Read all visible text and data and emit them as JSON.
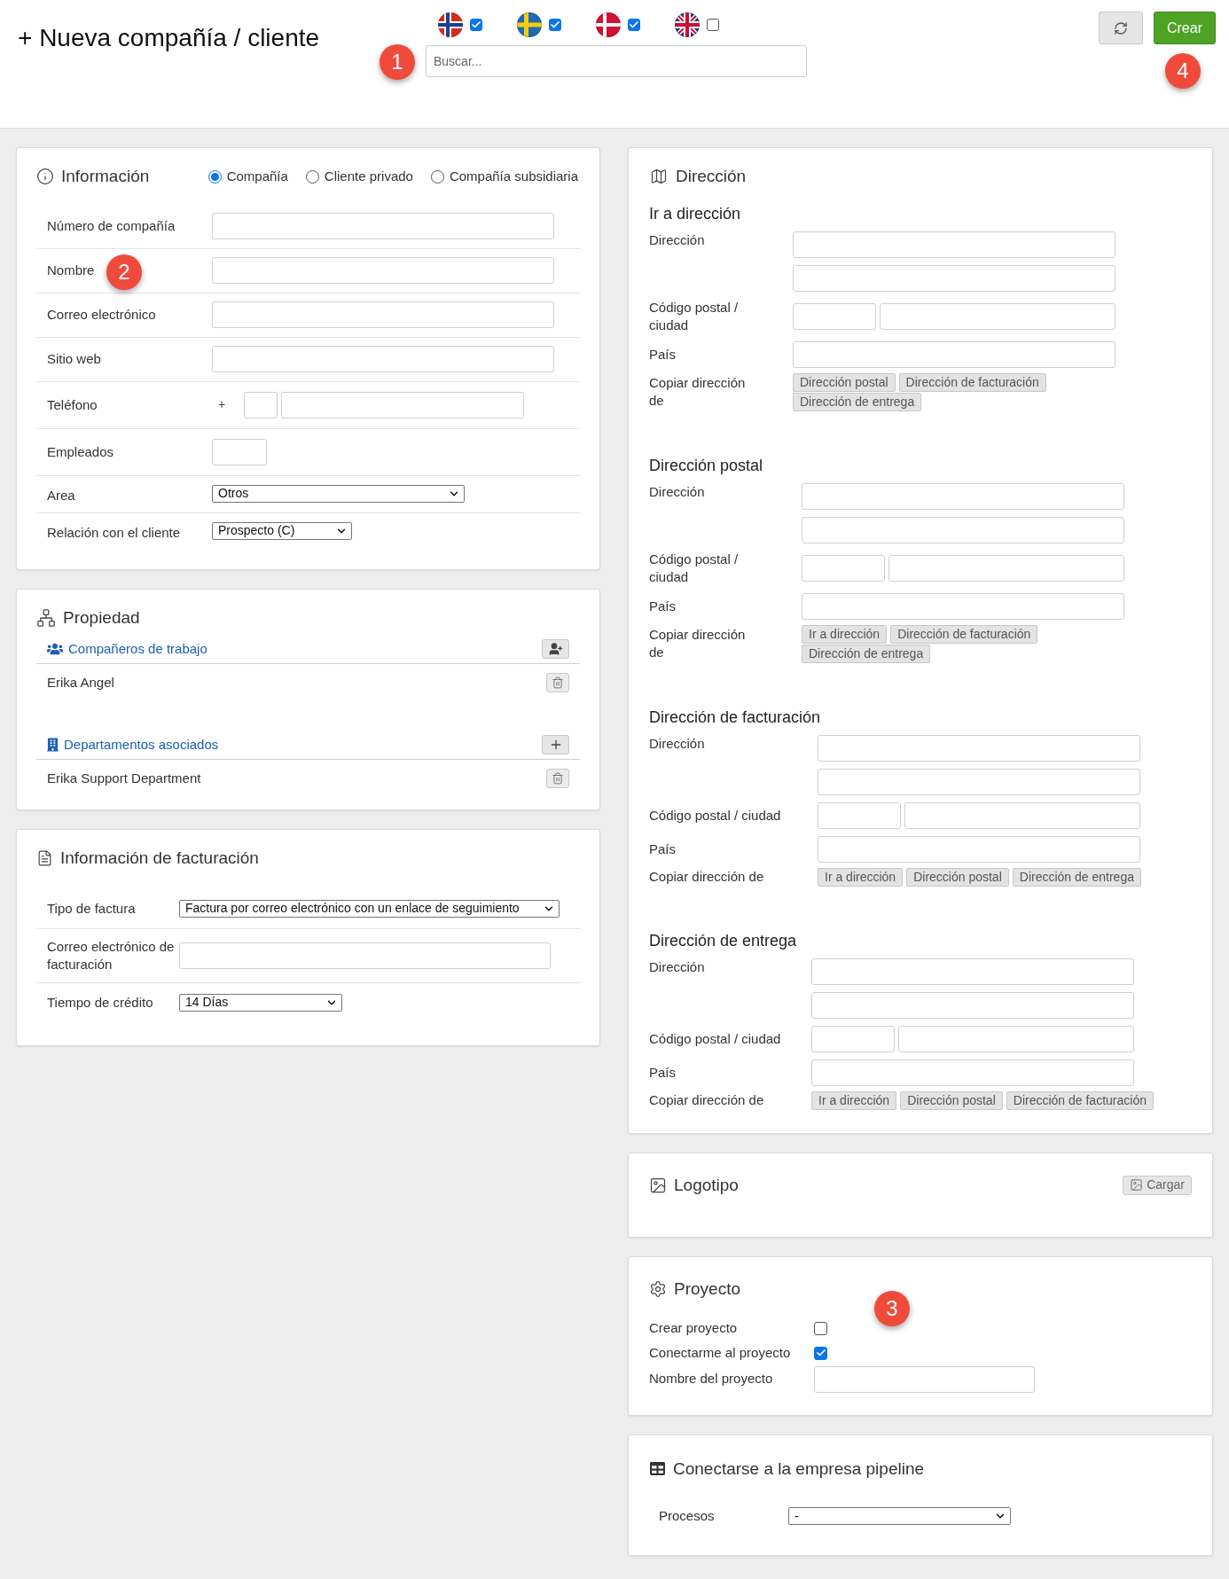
{
  "header": {
    "title": "+ Nueva compañía / cliente",
    "languages": [
      {
        "checked": true
      },
      {
        "checked": true
      },
      {
        "checked": true
      },
      {
        "checked": false
      }
    ],
    "search": {
      "placeholder": "Buscar..."
    },
    "create_button": "Crear"
  },
  "annotations": [
    "1",
    "2",
    "3",
    "4"
  ],
  "information": {
    "title": "Información",
    "customer_types": [
      {
        "label": "Compañía",
        "selected": true
      },
      {
        "label": "Cliente privado",
        "selected": false
      },
      {
        "label": "Compañía subsidiaria",
        "selected": false
      }
    ],
    "fields": [
      {
        "kind": "text",
        "label": "Número de compañía"
      },
      {
        "kind": "text",
        "label": "Nombre"
      },
      {
        "kind": "text",
        "label": "Correo electrónico"
      },
      {
        "kind": "text",
        "label": "Sitio web"
      },
      {
        "kind": "phone",
        "label": "Teléfono",
        "prefix": "+"
      },
      {
        "kind": "short",
        "label": "Empleados"
      },
      {
        "kind": "wideselect",
        "label": "Area",
        "value": "Otros"
      },
      {
        "kind": "select",
        "label": "Relación con el cliente",
        "value": "Prospecto (C)"
      }
    ]
  },
  "ownership": {
    "title": "Propiedad",
    "groups": [
      {
        "kind": "people",
        "title": "Compañeros de trabajo",
        "items": [
          "Erika Angel"
        ]
      },
      {
        "kind": "departments",
        "title": "Departamentos asociados",
        "items": [
          "Erika Support Department"
        ]
      }
    ]
  },
  "billing": {
    "title": "Información de facturación",
    "fields": [
      {
        "kind": "wideselect",
        "label": "Tipo de factura",
        "value": "Factura por correo electrónico con un enlace de seguimiento"
      },
      {
        "kind": "text",
        "label": "Correo electrónico de facturación"
      },
      {
        "kind": "select",
        "label": "Tiempo de crédito",
        "value": "14 Días"
      }
    ]
  },
  "address": {
    "title": "Dirección",
    "sections": [
      {
        "title": "Ir a dirección",
        "address_label": "Dirección",
        "postal_label": "Código postal / ciudad",
        "country_label": "País",
        "copy_label": "Copiar dirección de",
        "copy_buttons": [
          "Dirección postal",
          "Dirección de facturación",
          "Dirección de entrega"
        ]
      },
      {
        "title": "Dirección postal",
        "address_label": "Dirección",
        "postal_label": "Código postal / ciudad",
        "country_label": "País",
        "copy_label": "Copiar dirección de",
        "copy_buttons": [
          "Ir a dirección",
          "Dirección de facturación",
          "Dirección de entrega"
        ]
      },
      {
        "title": "Dirección de facturación",
        "address_label": "Dirección",
        "postal_label": "Código postal / ciudad",
        "country_label": "País",
        "copy_label": "Copiar dirección de",
        "copy_buttons": [
          "Ir a dirección",
          "Dirección postal",
          "Dirección de entrega"
        ]
      },
      {
        "title": "Dirección de entrega",
        "address_label": "Dirección",
        "postal_label": "Código postal / ciudad",
        "country_label": "País",
        "copy_label": "Copiar dirección de",
        "copy_buttons": [
          "Ir a dirección",
          "Dirección postal",
          "Dirección de facturación"
        ]
      }
    ]
  },
  "logo": {
    "title": "Logotipo",
    "upload_button": "Cargar"
  },
  "project": {
    "title": "Proyecto",
    "fields": [
      {
        "kind": "checkbox",
        "label": "Crear proyecto",
        "checked": false
      },
      {
        "kind": "checkbox",
        "label": "Conectarme al proyecto",
        "checked": true
      },
      {
        "kind": "text",
        "label": "Nombre del proyecto"
      }
    ]
  },
  "pipeline": {
    "title": "Conectarse a la empresa pipeline",
    "label": "Procesos",
    "value": "-"
  }
}
